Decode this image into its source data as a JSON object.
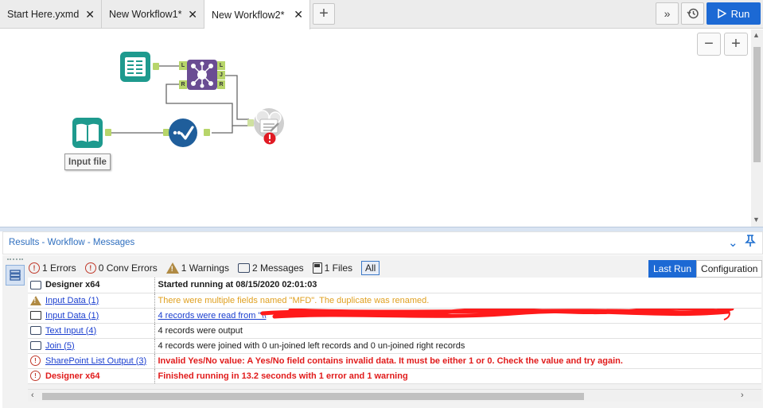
{
  "tabs": [
    {
      "label": "Start Here.yxmd",
      "close": "✕"
    },
    {
      "label": "New Workflow1*",
      "close": "✕"
    },
    {
      "label": "New Workflow2*",
      "close": "✕"
    }
  ],
  "toolbar": {
    "add_tab": "+",
    "overflow": "»",
    "history_icon": "history-icon",
    "run_label": "Run"
  },
  "canvas": {
    "zoom_out": "−",
    "zoom_in": "+",
    "input_node_label": "Input file",
    "anchors": {
      "left": "L",
      "right": "R",
      "join_left": "L",
      "join_join": "J",
      "join_right": "R"
    }
  },
  "results": {
    "title": "Results - Workflow - Messages",
    "filters": [
      {
        "label": "1 Errors",
        "icon": "error-icon"
      },
      {
        "label": "0 Conv Errors",
        "icon": "error-icon"
      },
      {
        "label": "1 Warnings",
        "icon": "warning-icon"
      },
      {
        "label": "2 Messages",
        "icon": "message-icon"
      },
      {
        "label": "1 Files",
        "icon": "file-icon"
      },
      {
        "label": "All",
        "icon": ""
      }
    ],
    "view_tabs": [
      "Last Run",
      "Configuration"
    ],
    "rows": [
      {
        "icon": "message",
        "source": "Designer x64",
        "message": "Started running at 08/15/2020 02:01:03",
        "style": "bold"
      },
      {
        "icon": "warning",
        "source": "Input Data (1)",
        "message": "There were multiple fields named \"MFD\".  The duplicate was renamed.",
        "style": "orange"
      },
      {
        "icon": "folder",
        "source": "Input Data (1)",
        "message": "4 records were read from \"\\\\",
        "style": "link"
      },
      {
        "icon": "message",
        "source": "Text Input (4)",
        "message": "4 records were output",
        "style": "normal"
      },
      {
        "icon": "message",
        "source": "Join (5)",
        "message": "4 records were joined with 0 un-joined left records and 0 un-joined right records",
        "style": "normal"
      },
      {
        "icon": "error",
        "source": "SharePoint List Output (3)",
        "message": "Invalid Yes/No value: A Yes/No field contains invalid data. It must be either 1 or 0. Check the value and try again.",
        "style": "red"
      },
      {
        "icon": "error",
        "source": "Designer x64",
        "message": "Finished running in 13.2 seconds with 1 error and 1 warning",
        "style": "red"
      }
    ]
  },
  "colors": {
    "accent": "#1c69d4",
    "error": "#e11b1b",
    "warning": "#e0a020",
    "link": "#1a3ecf",
    "tool_teal": "#1e9a8e",
    "tool_purple": "#6a4c93",
    "tool_blue": "#1f5e9b"
  }
}
